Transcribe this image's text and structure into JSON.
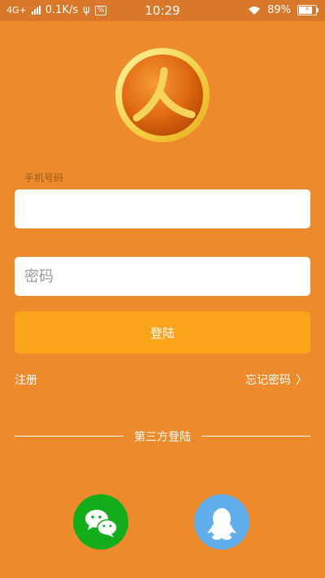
{
  "status_bar": {
    "network": "4G+",
    "speed": "0.1K/s",
    "sim_icon": "sim-icon",
    "time": "10:29",
    "battery": "89%",
    "colors": {
      "bar": "#D9782A"
    }
  },
  "login": {
    "phone_label": "手机号码",
    "phone_value": "",
    "password_placeholder": "密码",
    "login_button": "登陆",
    "register_link": "注册",
    "forgot_link": "忘记密码",
    "forgot_chevron": "〉"
  },
  "third_party": {
    "label": "第三方登陆",
    "providers": [
      {
        "name": "wechat",
        "icon": "wechat-icon",
        "color": "#13AD1B"
      },
      {
        "name": "qq",
        "icon": "qq-icon",
        "color": "#61AEEC"
      }
    ]
  },
  "colors": {
    "background": "#EC8A2C",
    "button": "#FBA51B"
  }
}
